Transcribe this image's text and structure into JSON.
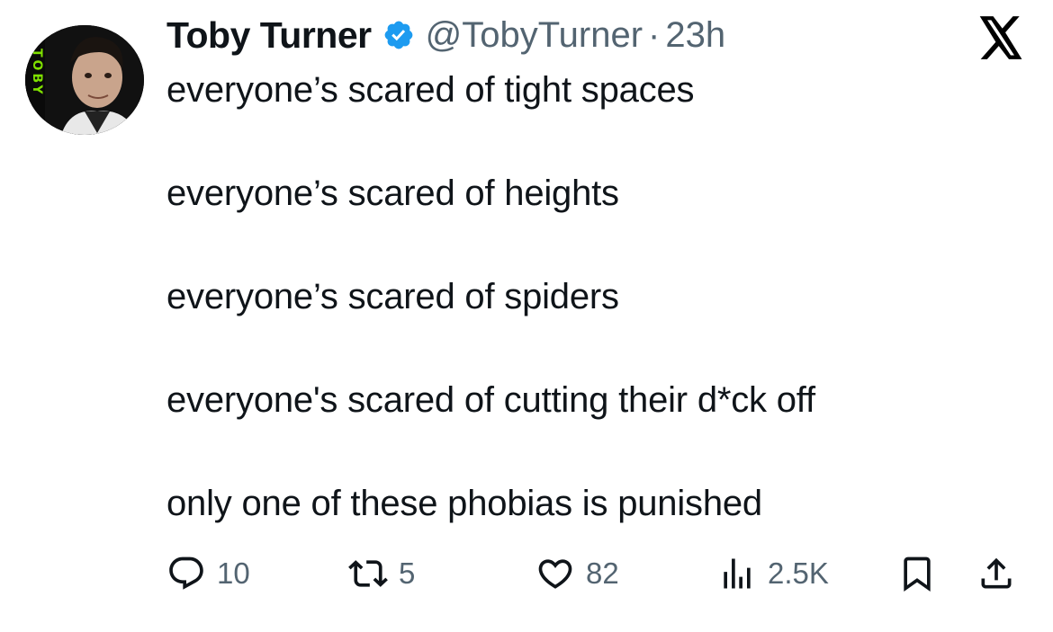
{
  "author": {
    "display_name": "Toby Turner",
    "handle": "@TobyTurner",
    "separator": "·",
    "time": "23h",
    "verified_icon": "verified-badge-icon",
    "verified_color": "#1d9bf0",
    "avatar_text": "TOBY",
    "avatar_accent": "#7fe000"
  },
  "platform_logo": "x-logo-icon",
  "tweet_lines": [
    "everyone’s scared of tight spaces",
    "everyone’s scared of heights",
    "everyone’s scared of spiders",
    "everyone's scared of cutting their d*ck off",
    "only one of these phobias is punished"
  ],
  "actions": {
    "reply": {
      "icon": "reply-icon",
      "count": "10"
    },
    "retweet": {
      "icon": "retweet-icon",
      "count": "5"
    },
    "like": {
      "icon": "heart-icon",
      "count": "82"
    },
    "views": {
      "icon": "views-icon",
      "count": "2.5K"
    },
    "bookmark": {
      "icon": "bookmark-icon"
    },
    "share": {
      "icon": "share-icon"
    }
  },
  "colors": {
    "text_primary": "#0f1419",
    "text_secondary": "#536471"
  }
}
